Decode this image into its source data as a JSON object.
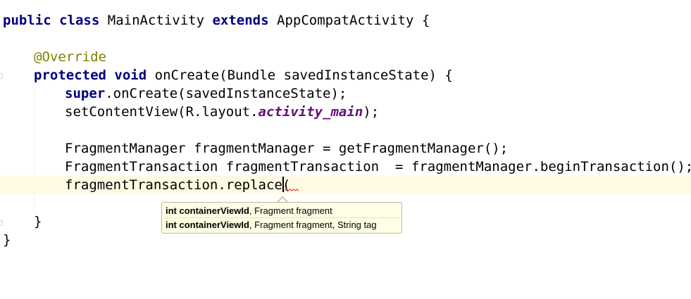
{
  "editor": {
    "lines": {
      "l1": {
        "kw_public": "public",
        "kw_class": "class",
        "class_name": "MainActivity",
        "kw_extends": "extends",
        "superclass": "AppCompatActivity {"
      },
      "l3": {
        "annotation": "@Override"
      },
      "l4": {
        "kw_protected": "protected",
        "kw_void": "void",
        "rest": "onCreate(Bundle savedInstanceState) {"
      },
      "l5": {
        "kw_super": "super",
        "rest": ".onCreate(savedInstanceState);"
      },
      "l6": {
        "prefix": "setContentView(R.layout.",
        "field": "activity_main",
        "suffix": ");"
      },
      "l8": {
        "text": "FragmentManager fragmentManager = getFragmentManager();"
      },
      "l9": {
        "text": "FragmentTransaction fragmentTransaction  = fragmentManager.beginTransaction();"
      },
      "l10": {
        "text": "fragmentTransaction.replace("
      },
      "l12": {
        "text": "}"
      },
      "l13": {
        "text": "}"
      }
    },
    "parameter_info": {
      "signature_1": {
        "param_bold": "int containerViewId",
        "rest": ", Fragment fragment"
      },
      "signature_2": {
        "param_bold": "int containerViewId",
        "rest": ", Fragment fragment, String tag"
      }
    },
    "colors": {
      "keyword": "#000080",
      "annotation": "#808000",
      "static_field": "#660e7a",
      "current_line": "#fffae3",
      "tooltip_bg": "#fefee4",
      "error_squiggle": "#e02020"
    }
  }
}
